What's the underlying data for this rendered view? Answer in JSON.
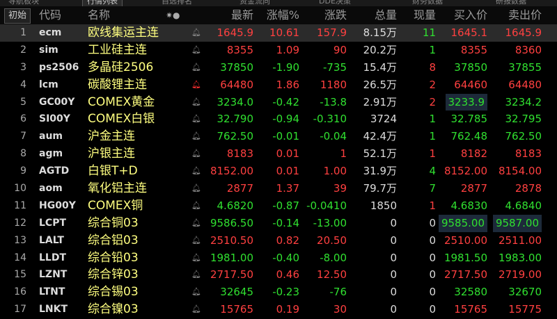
{
  "tabs": [
    "导航板块",
    "行情列表",
    "自选排名",
    "资金流向",
    "DDE决策",
    "财务数据",
    "研报数据"
  ],
  "header": {
    "init": "初始",
    "code": "代码",
    "name": "名称",
    "last": "最新",
    "pct": "涨幅%",
    "chg": "涨跌",
    "vol": "总量",
    "cur": "现量",
    "bid": "买入价",
    "ask": "卖出价"
  },
  "rows": [
    {
      "idx": "1",
      "code": "ecm",
      "name": "欧线集运主连",
      "last": "1645.9",
      "pct": "10.61",
      "chg": "157.9",
      "vol": "8.15万",
      "cur": "11",
      "bid": "1645.1",
      "ask": "1645.9",
      "dir": "up",
      "cur_color": "green",
      "alert": false,
      "bid_hl": false,
      "ask_hl": false,
      "selected": true
    },
    {
      "idx": "2",
      "code": "sim",
      "name": "工业硅主连",
      "last": "8355",
      "pct": "1.09",
      "chg": "90",
      "vol": "20.2万",
      "cur": "1",
      "bid": "8355",
      "ask": "8360",
      "dir": "up",
      "cur_color": "green",
      "alert": false,
      "bid_hl": false,
      "ask_hl": false,
      "selected": false
    },
    {
      "idx": "3",
      "code": "ps2506",
      "name": "多晶硅2506",
      "last": "37850",
      "pct": "-1.90",
      "chg": "-735",
      "vol": "15.4万",
      "cur": "8",
      "bid": "37850",
      "ask": "37855",
      "dir": "down",
      "cur_color": "red",
      "alert": false,
      "bid_hl": false,
      "ask_hl": false,
      "selected": false
    },
    {
      "idx": "4",
      "code": "lcm",
      "name": "碳酸锂主连",
      "last": "64480",
      "pct": "1.86",
      "chg": "1180",
      "vol": "26.5万",
      "cur": "2",
      "bid": "64460",
      "ask": "64480",
      "dir": "up",
      "cur_color": "red",
      "alert": true,
      "bid_hl": false,
      "ask_hl": false,
      "selected": false
    },
    {
      "idx": "5",
      "code": "GC00Y",
      "name": "COMEX黄金",
      "last": "3234.0",
      "pct": "-0.42",
      "chg": "-13.8",
      "vol": "2.91万",
      "cur": "2",
      "bid": "3233.9",
      "ask": "3234.2",
      "dir": "down",
      "cur_color": "red",
      "alert": false,
      "bid_hl": true,
      "ask_hl": false,
      "selected": false
    },
    {
      "idx": "6",
      "code": "SI00Y",
      "name": "COMEX白银",
      "last": "32.790",
      "pct": "-0.94",
      "chg": "-0.310",
      "vol": "3724",
      "cur": "1",
      "bid": "32.785",
      "ask": "32.795",
      "dir": "down",
      "cur_color": "green",
      "alert": false,
      "bid_hl": false,
      "ask_hl": false,
      "selected": false
    },
    {
      "idx": "7",
      "code": "aum",
      "name": "沪金主连",
      "last": "762.50",
      "pct": "-0.01",
      "chg": "-0.04",
      "vol": "42.4万",
      "cur": "1",
      "bid": "762.48",
      "ask": "762.50",
      "dir": "down",
      "cur_color": "green",
      "alert": false,
      "bid_hl": false,
      "ask_hl": false,
      "selected": false
    },
    {
      "idx": "8",
      "code": "agm",
      "name": "沪银主连",
      "last": "8183",
      "pct": "0.01",
      "chg": "1",
      "vol": "52.1万",
      "cur": "1",
      "bid": "8182",
      "ask": "8183",
      "dir": "up",
      "cur_color": "red",
      "alert": false,
      "bid_hl": false,
      "ask_hl": false,
      "selected": false
    },
    {
      "idx": "9",
      "code": "AGTD",
      "name": "白银T+D",
      "last": "8152.00",
      "pct": "0.01",
      "chg": "1.00",
      "vol": "31.9万",
      "cur": "4",
      "bid": "8152.00",
      "ask": "8154.00",
      "dir": "up",
      "cur_color": "green",
      "alert": false,
      "bid_hl": false,
      "ask_hl": false,
      "selected": false
    },
    {
      "idx": "10",
      "code": "aom",
      "name": "氧化铝主连",
      "last": "2877",
      "pct": "1.37",
      "chg": "39",
      "vol": "79.7万",
      "cur": "7",
      "bid": "2877",
      "ask": "2878",
      "dir": "up",
      "cur_color": "green",
      "alert": false,
      "bid_hl": false,
      "ask_hl": false,
      "selected": false
    },
    {
      "idx": "11",
      "code": "HG00Y",
      "name": "COMEX铜",
      "last": "4.6820",
      "pct": "-0.87",
      "chg": "-0.0410",
      "vol": "1850",
      "cur": "1",
      "bid": "4.6830",
      "ask": "4.6840",
      "dir": "down",
      "cur_color": "red",
      "alert": false,
      "bid_hl": false,
      "ask_hl": false,
      "selected": false
    },
    {
      "idx": "12",
      "code": "LCPT",
      "name": "综合铜03",
      "last": "9586.50",
      "pct": "-0.14",
      "chg": "-13.00",
      "vol": "0",
      "cur": "0",
      "bid": "9585.00",
      "ask": "9587.00",
      "dir": "down",
      "cur_color": "white",
      "alert": false,
      "bid_hl": true,
      "ask_hl": true,
      "selected": false
    },
    {
      "idx": "13",
      "code": "LALT",
      "name": "综合铝03",
      "last": "2510.50",
      "pct": "0.82",
      "chg": "20.50",
      "vol": "0",
      "cur": "0",
      "bid": "2510.00",
      "ask": "2511.00",
      "dir": "up",
      "cur_color": "white",
      "alert": false,
      "bid_hl": false,
      "ask_hl": false,
      "selected": false
    },
    {
      "idx": "14",
      "code": "LLDT",
      "name": "综合铅03",
      "last": "1981.00",
      "pct": "-0.40",
      "chg": "-8.00",
      "vol": "0",
      "cur": "0",
      "bid": "1981.50",
      "ask": "1983.00",
      "dir": "down",
      "cur_color": "white",
      "alert": false,
      "bid_hl": false,
      "ask_hl": false,
      "selected": false
    },
    {
      "idx": "15",
      "code": "LZNT",
      "name": "综合锌03",
      "last": "2717.50",
      "pct": "0.46",
      "chg": "12.50",
      "vol": "0",
      "cur": "0",
      "bid": "2717.50",
      "ask": "2719.00",
      "dir": "up",
      "cur_color": "white",
      "alert": false,
      "bid_hl": false,
      "ask_hl": false,
      "selected": false
    },
    {
      "idx": "16",
      "code": "LTNT",
      "name": "综合锡03",
      "last": "32645",
      "pct": "-0.23",
      "chg": "-76",
      "vol": "0",
      "cur": "0",
      "bid": "32580",
      "ask": "32670",
      "dir": "down",
      "cur_color": "white",
      "alert": false,
      "bid_hl": false,
      "ask_hl": false,
      "selected": false
    },
    {
      "idx": "17",
      "code": "LNKT",
      "name": "综合镍03",
      "last": "15765",
      "pct": "0.19",
      "chg": "30",
      "vol": "0",
      "cur": "0",
      "bid": "15765",
      "ask": "15775",
      "dir": "up",
      "cur_color": "white",
      "alert": false,
      "bid_hl": false,
      "ask_hl": false,
      "selected": false
    }
  ],
  "colors": {
    "up": "#ff4040",
    "down": "#30e030",
    "name": "#ffff80",
    "alert": "#ff3030"
  }
}
